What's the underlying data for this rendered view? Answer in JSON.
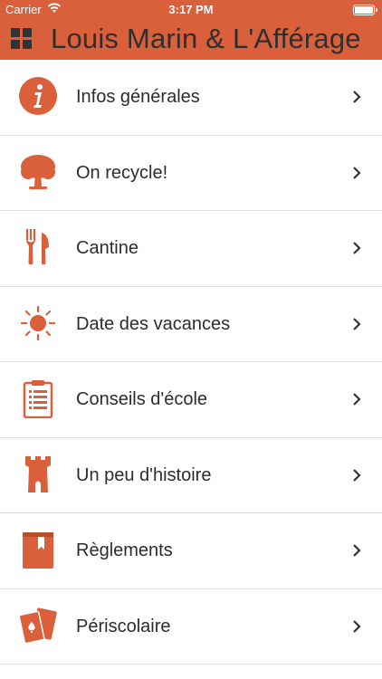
{
  "status": {
    "carrier": "Carrier",
    "time": "3:17 PM"
  },
  "header": {
    "title": "Louis Marin & L'Afférage"
  },
  "menu": [
    {
      "label": "Infos générales",
      "icon": "info-icon"
    },
    {
      "label": "On recycle!",
      "icon": "tree-icon"
    },
    {
      "label": "Cantine",
      "icon": "fork-knife-icon"
    },
    {
      "label": "Date des vacances",
      "icon": "sun-icon"
    },
    {
      "label": "Conseils d'école",
      "icon": "clipboard-icon"
    },
    {
      "label": "Un peu d'histoire",
      "icon": "tower-icon"
    },
    {
      "label": "Règlements",
      "icon": "book-icon"
    },
    {
      "label": "Périscolaire",
      "icon": "cards-icon"
    }
  ],
  "colors": {
    "accent": "#D9603B",
    "text": "#2c2c2c"
  }
}
